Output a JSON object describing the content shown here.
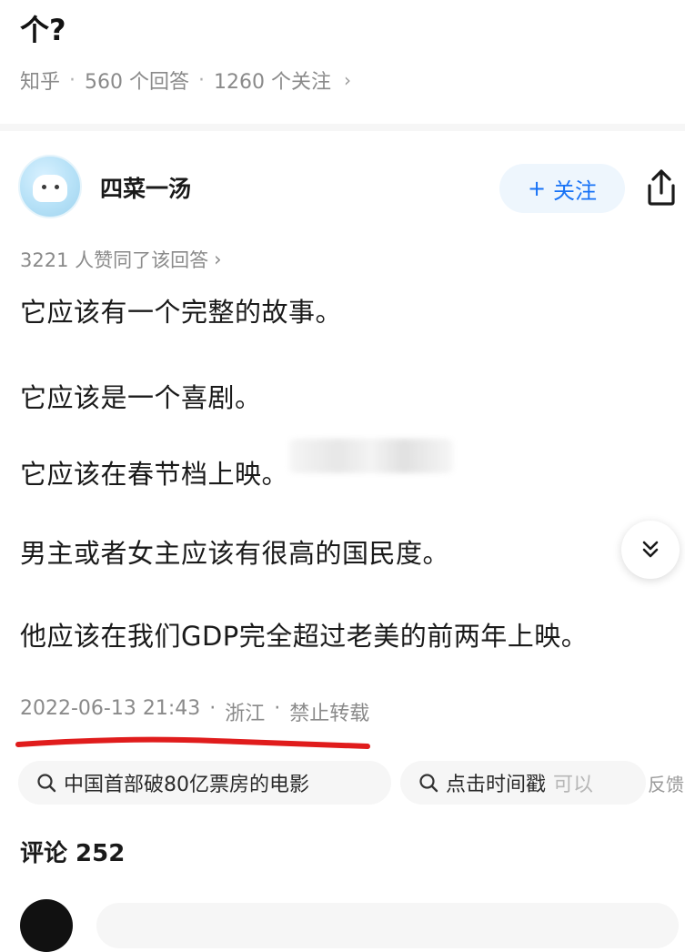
{
  "question": {
    "title_tail": "个?",
    "source": "知乎",
    "answers": "560 个回答",
    "followers": "1260 个关注"
  },
  "answer": {
    "author": "四菜一汤",
    "follow_label": "关注",
    "agree_text": "3221 人赞同了该回答",
    "paragraphs": [
      "它应该有一个完整的故事。",
      "它应该是一个喜剧。",
      "它应该在春节档上映。",
      "男主或者女主应该有很高的国民度。",
      "他应该在我们GDP完全超过老美的前两年上映。"
    ],
    "timestamp": "2022-06-13 21:43",
    "location": "浙江",
    "copyright": "禁止转载"
  },
  "search_chips": [
    {
      "text": "中国首部破80亿票房的电影"
    },
    {
      "text": "点击时间戳",
      "fade_text": "可以"
    }
  ],
  "feedback_label": "反馈",
  "comments": {
    "label": "评论 252"
  },
  "colors": {
    "accent": "#1772f6",
    "annotation_red": "#e01c1c"
  },
  "icons": [
    "chevron-right-icon",
    "plus-icon",
    "share-icon",
    "double-chevron-down-icon",
    "search-icon"
  ]
}
